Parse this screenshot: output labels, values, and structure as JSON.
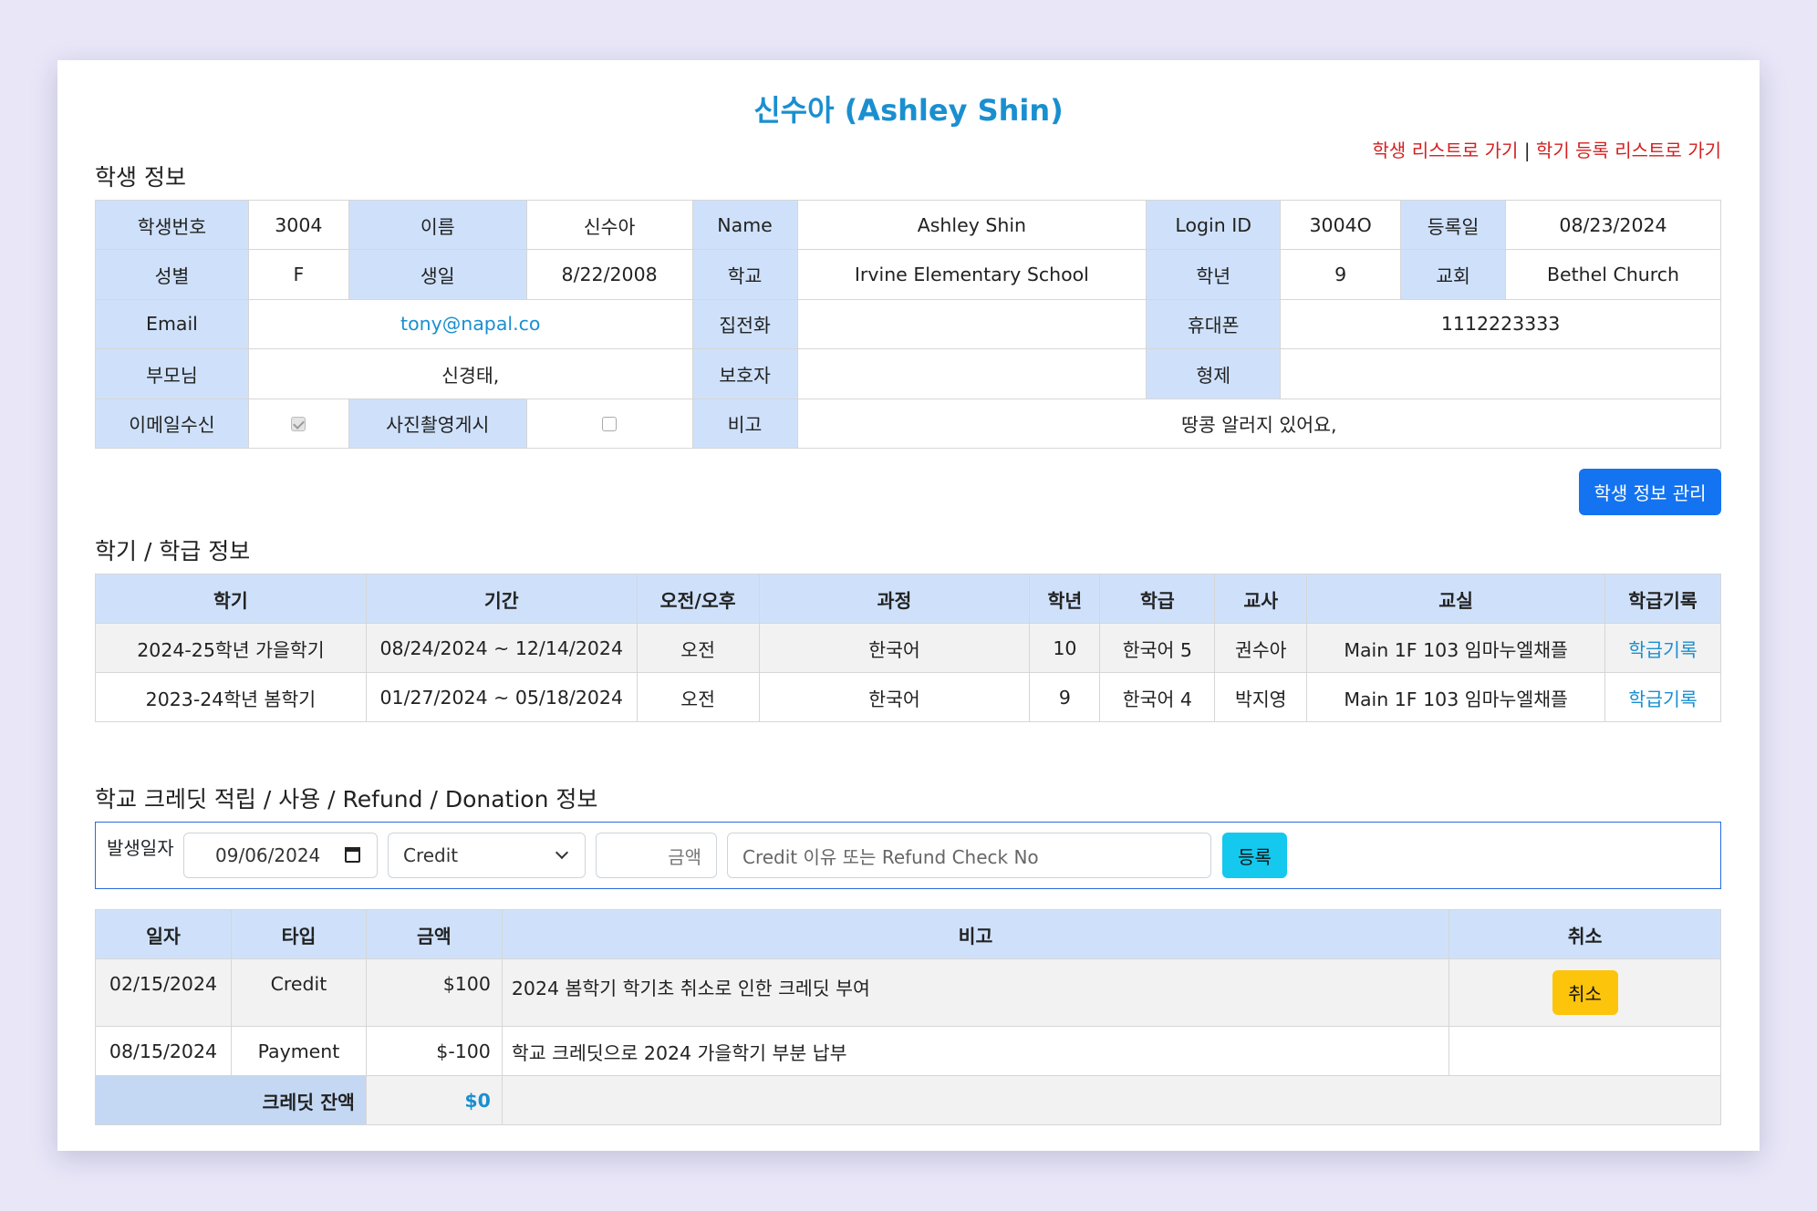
{
  "title": "신수아 (Ashley Shin)",
  "nav": {
    "student_list": "학생 리스트로 가기",
    "separator": "|",
    "term_list": "학기 등록 리스트로 가기"
  },
  "student_section_title": "학생 정보",
  "student": {
    "id_label": "학생번호",
    "id": "3004",
    "name_ko_label": "이름",
    "name_ko": "신수아",
    "name_en_label": "Name",
    "name_en": "Ashley Shin",
    "login_label": "Login ID",
    "login": "3004O",
    "reg_date_label": "등록일",
    "reg_date": "08/23/2024",
    "gender_label": "성별",
    "gender": "F",
    "birth_label": "생일",
    "birth": "8/22/2008",
    "school_label": "학교",
    "school": "Irvine Elementary School",
    "grade_label": "학년",
    "grade": "9",
    "church_label": "교회",
    "church": "Bethel Church",
    "email_label": "Email",
    "email": "tony@napal.co",
    "home_phone_label": "집전화",
    "home_phone": "",
    "mobile_label": "휴대폰",
    "mobile": "1112223333",
    "parents_label": "부모님",
    "parents": "신경태,",
    "guardian_label": "보호자",
    "guardian": "",
    "siblings_label": "형제",
    "siblings": "",
    "email_opt_label": "이메일수신",
    "email_opt": true,
    "photo_opt_label": "사진촬영게시",
    "photo_opt": false,
    "note_label": "비고",
    "note": "땅콩 알러지 있어요,"
  },
  "manage_button": "학생 정보 관리",
  "terms_section_title": "학기 / 학급 정보",
  "terms": {
    "headers": [
      "학기",
      "기간",
      "오전/오후",
      "과정",
      "학년",
      "학급",
      "교사",
      "교실",
      "학급기록"
    ],
    "rows": [
      [
        "2024-25학년 가을학기",
        "08/24/2024 ~ 12/14/2024",
        "오전",
        "한국어",
        "10",
        "한국어 5",
        "권수아",
        "Main 1F 103 임마누엘채플",
        "학급기록"
      ],
      [
        "2023-24학년 봄학기",
        "01/27/2024 ~ 05/18/2024",
        "오전",
        "한국어",
        "9",
        "한국어 4",
        "박지영",
        "Main 1F 103 임마누엘채플",
        "학급기록"
      ]
    ]
  },
  "credit_section_title": "학교 크레딧 적립 / 사용 / Refund / Donation 정보",
  "credit_form": {
    "date_label": "발생일자",
    "date_value": "09/06/2024",
    "type_value": "Credit",
    "amount_placeholder": "금액",
    "note_placeholder": "Credit 이유 또는 Refund Check No",
    "submit": "등록"
  },
  "ledger": {
    "headers": [
      "일자",
      "타입",
      "금액",
      "비고",
      "취소"
    ],
    "rows": [
      {
        "date": "02/15/2024",
        "type": "Credit",
        "amount": "$100",
        "note": "2024 봄학기 학기초 취소로 인한 크레딧 부여",
        "cancel": "취소"
      },
      {
        "date": "08/15/2024",
        "type": "Payment",
        "amount": "$-100",
        "note": "학교 크레딧으로 2024 가을학기 부분 납부",
        "cancel": ""
      }
    ],
    "balance_label": "크레딧 잔액",
    "balance_value": "$0"
  },
  "colors": {
    "accent": "#1a8fd0",
    "header_bg": "#cfe1fa",
    "link_red": "#d32020",
    "primary_button": "#1473f0",
    "info_button": "#14c8ee",
    "warning_button": "#fcc40a"
  }
}
